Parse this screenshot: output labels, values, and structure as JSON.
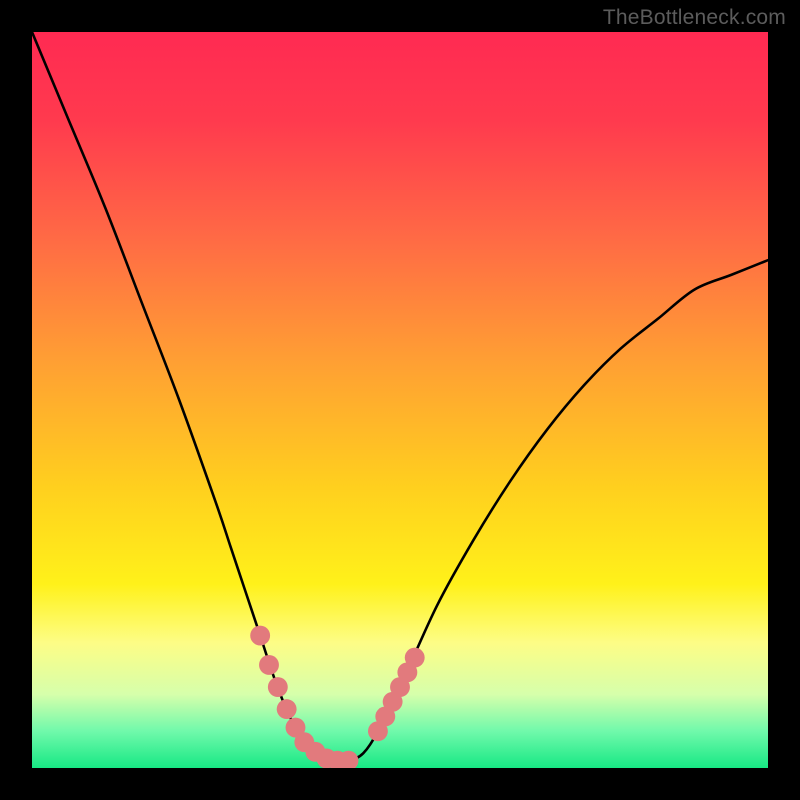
{
  "watermark": "TheBottleneck.com",
  "colors": {
    "frame": "#000000",
    "curve": "#000000",
    "marker": "#e27a7d",
    "gradient_stops": [
      {
        "offset": 0.0,
        "color": "#ff2a52"
      },
      {
        "offset": 0.12,
        "color": "#ff3a4e"
      },
      {
        "offset": 0.28,
        "color": "#ff6a45"
      },
      {
        "offset": 0.45,
        "color": "#ffa033"
      },
      {
        "offset": 0.62,
        "color": "#ffd01e"
      },
      {
        "offset": 0.75,
        "color": "#fff11a"
      },
      {
        "offset": 0.83,
        "color": "#fdfd86"
      },
      {
        "offset": 0.9,
        "color": "#d6ffab"
      },
      {
        "offset": 0.95,
        "color": "#70f9ab"
      },
      {
        "offset": 1.0,
        "color": "#17e884"
      }
    ]
  },
  "chart_data": {
    "type": "line",
    "title": "",
    "xlabel": "",
    "ylabel": "",
    "xlim": [
      0,
      100
    ],
    "ylim": [
      0,
      100
    ],
    "grid": false,
    "series": [
      {
        "name": "curve",
        "x": [
          0,
          5,
          10,
          15,
          20,
          25,
          27,
          29,
          31,
          33,
          35,
          37,
          39,
          41,
          43,
          45,
          47,
          50,
          55,
          60,
          65,
          70,
          75,
          80,
          85,
          90,
          95,
          100
        ],
        "values": [
          100,
          88,
          76,
          63,
          50,
          36,
          30,
          24,
          18,
          12,
          7,
          4,
          2,
          1,
          1,
          2,
          5,
          11,
          22,
          31,
          39,
          46,
          52,
          57,
          61,
          65,
          67,
          69
        ]
      }
    ],
    "markers": {
      "left": [
        {
          "x": 31,
          "y": 18
        },
        {
          "x": 32.2,
          "y": 14
        },
        {
          "x": 33.4,
          "y": 11
        },
        {
          "x": 34.6,
          "y": 8
        },
        {
          "x": 35.8,
          "y": 5.5
        },
        {
          "x": 37,
          "y": 3.5
        },
        {
          "x": 38.5,
          "y": 2.2
        },
        {
          "x": 40,
          "y": 1.3
        },
        {
          "x": 41.5,
          "y": 1
        },
        {
          "x": 43,
          "y": 1
        }
      ],
      "right": [
        {
          "x": 47,
          "y": 5
        },
        {
          "x": 48,
          "y": 7
        },
        {
          "x": 49,
          "y": 9
        },
        {
          "x": 50,
          "y": 11
        },
        {
          "x": 51,
          "y": 13
        },
        {
          "x": 52,
          "y": 15
        }
      ]
    }
  }
}
